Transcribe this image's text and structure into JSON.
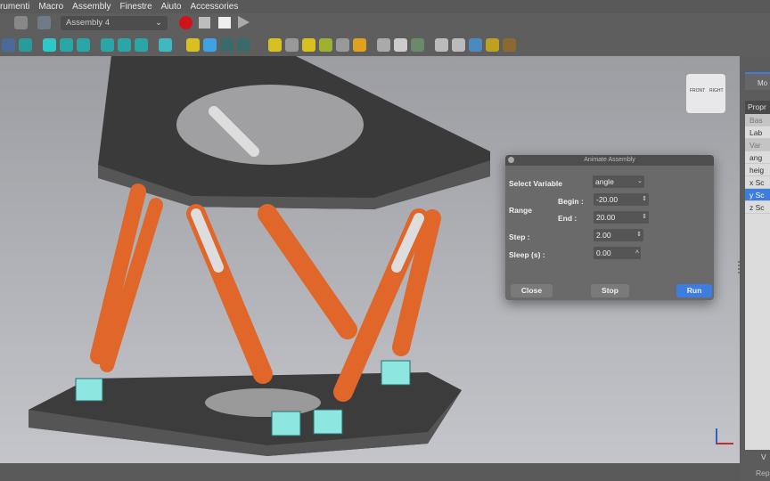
{
  "menu": [
    "rumenti",
    "Macro",
    "Assembly",
    "Finestre",
    "Aiuto",
    "Accessories"
  ],
  "toolbar": {
    "workbench": "Assembly 4"
  },
  "dialog": {
    "title": "Animate Assembly",
    "select_variable_label": "Select Variable",
    "variable": "angle",
    "range_label": "Range",
    "begin_label": "Begin :",
    "begin": "-20.00",
    "end_label": "End :",
    "end": "20.00",
    "step_label": "Step :",
    "step": "2.00",
    "sleep_label": "Sleep (s) :",
    "sleep": "0.00",
    "close": "Close",
    "stop": "Stop",
    "run": "Run"
  },
  "panel": {
    "tab": "Mo",
    "header": "Propr",
    "rows": [
      "Bas",
      "Lab",
      "Var",
      "ang",
      "heig",
      "x Sc",
      "y Sc",
      "z Sc"
    ],
    "bottom_tab": "V",
    "status": "Rep"
  },
  "navcube": {
    "front": "FRONT",
    "right": "RIGHT"
  },
  "colors": {
    "accent": "#3d7de0",
    "orange": "#e0662a",
    "plate": "#3e3e3e",
    "cyan": "#8ee6e0"
  }
}
